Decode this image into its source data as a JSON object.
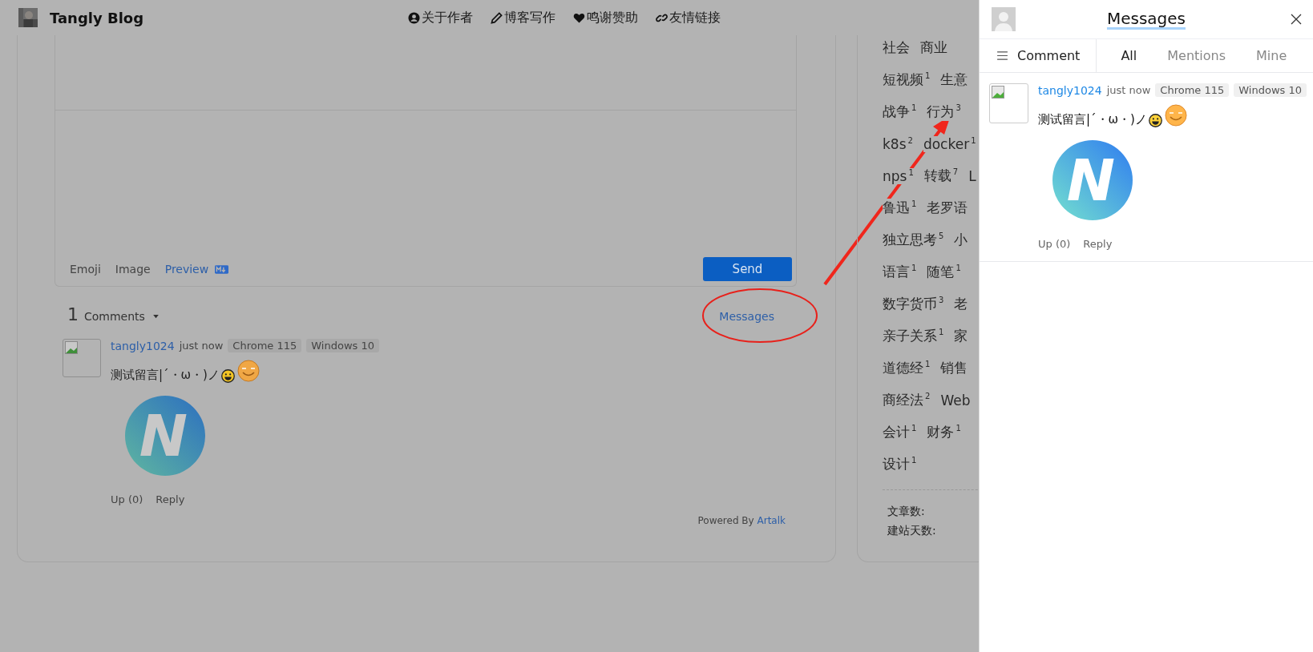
{
  "header": {
    "site_title": "Tangly Blog",
    "nav": [
      {
        "label": "关于作者"
      },
      {
        "label": "博客写作"
      },
      {
        "label": "鸣谢赞助"
      },
      {
        "label": "友情链接"
      }
    ]
  },
  "editor": {
    "tools": [
      "Emoji",
      "Image"
    ],
    "preview": "Preview",
    "send_button": "Send"
  },
  "comments_bar": {
    "count": "1",
    "label": "Comments",
    "messages_link": "Messages"
  },
  "comments": [
    {
      "author": "tangly1024",
      "time": "just now",
      "badges": [
        "Chrome 115",
        "Windows 10"
      ],
      "text": "测试留言|´・ω・)ノ",
      "image_letter": "N",
      "actions": [
        "Up (0)",
        "Reply"
      ]
    }
  ],
  "powered_by": {
    "text": "Powered By",
    "link": "Artalk"
  },
  "tag_cloud": {
    "rows": [
      [
        {
          "name": "社会"
        },
        {
          "name": "商业"
        }
      ],
      [
        {
          "name": "短视频",
          "count": "1"
        },
        {
          "name": "生意"
        }
      ],
      [
        {
          "name": "战争",
          "count": "1"
        },
        {
          "name": "行为",
          "count": "3"
        }
      ],
      [
        {
          "name": "k8s",
          "count": "2"
        },
        {
          "name": "docker",
          "count": "1"
        }
      ],
      [
        {
          "name": "nps",
          "count": "1"
        },
        {
          "name": "转载",
          "count": "7"
        },
        {
          "name": "L"
        }
      ],
      [
        {
          "name": "鲁迅",
          "count": "1"
        },
        {
          "name": "老罗语"
        }
      ],
      [
        {
          "name": "独立思考",
          "count": "5"
        },
        {
          "name": "小"
        }
      ],
      [
        {
          "name": "语言",
          "count": "1"
        },
        {
          "name": "随笔",
          "count": "1"
        }
      ],
      [
        {
          "name": "数字货币",
          "count": "3"
        },
        {
          "name": "老"
        }
      ],
      [
        {
          "name": "亲子关系",
          "count": "1"
        },
        {
          "name": "家"
        }
      ],
      [
        {
          "name": "道德经",
          "count": "1"
        },
        {
          "name": "销售"
        }
      ],
      [
        {
          "name": "商经法",
          "count": "2"
        },
        {
          "name": "Web"
        }
      ],
      [
        {
          "name": "会计",
          "count": "1"
        },
        {
          "name": "财务",
          "count": "1"
        }
      ],
      [
        {
          "name": "设计",
          "count": "1"
        }
      ]
    ]
  },
  "site_stats": [
    "文章数:",
    "建站天数:"
  ],
  "panel": {
    "title": "Messages",
    "comment_menu": "Comment",
    "tabs": [
      {
        "label": "All",
        "selected": true
      },
      {
        "label": "Mentions",
        "selected": false
      },
      {
        "label": "Mine",
        "selected": false
      }
    ],
    "comments": [
      {
        "author": "tangly1024",
        "time": "just now",
        "badges": [
          "Chrome 115",
          "Windows 10"
        ],
        "text": "测试留言|´・ω・)ノ",
        "image_letter": "N",
        "actions": [
          "Up (0)",
          "Reply"
        ]
      }
    ]
  }
}
